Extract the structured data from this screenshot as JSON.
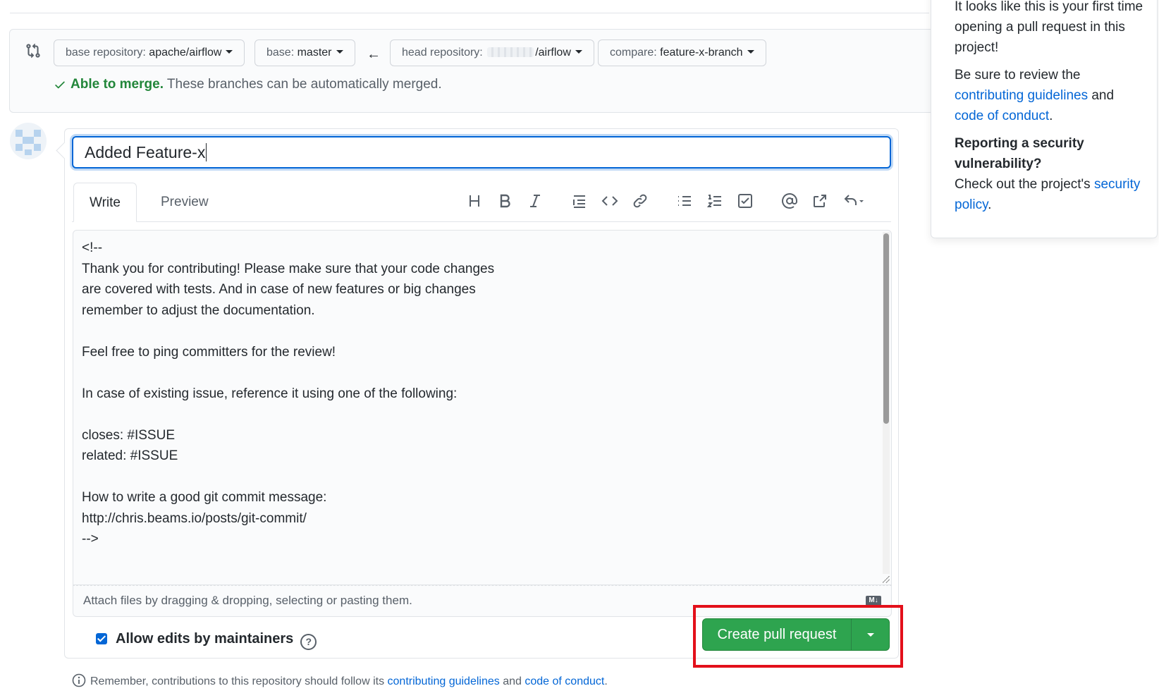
{
  "compare": {
    "base_repo_label": "base repository:",
    "base_repo_value": "apache/airflow",
    "base_label": "base:",
    "base_value": "master",
    "head_repo_label": "head repository:",
    "head_repo_value": "/airflow",
    "compare_label": "compare:",
    "compare_value": "feature-x-branch",
    "merge_ok": "Able to merge.",
    "merge_text": "These branches can be automatically merged."
  },
  "form": {
    "title_value": "Added Feature-x",
    "tab_write": "Write",
    "tab_preview": "Preview",
    "body_text": "<!--\nThank you for contributing! Please make sure that your code changes\nare covered with tests. And in case of new features or big changes\nremember to adjust the documentation.\n\nFeel free to ping committers for the review!\n\nIn case of existing issue, reference it using one of the following:\n\ncloses: #ISSUE\nrelated: #ISSUE\n\nHow to write a good git commit message:\nhttp://chris.beams.io/posts/git-commit/\n-->",
    "attach_text": "Attach files by dragging & dropping, selecting or pasting them.",
    "md_badge": "M↓",
    "allow_edits": "Allow edits by maintainers",
    "help_glyph": "?",
    "create_button": "Create pull request"
  },
  "footnote": {
    "prefix": "Remember, contributions to this repository should follow its",
    "link1": "contributing guidelines",
    "and": "and",
    "link2": "code of conduct",
    "suffix": "."
  },
  "side": {
    "intro_line": "It looks like this is your first time opening a pull request in this project!",
    "review_prefix": "Be sure to review the",
    "review_link1": "contributing guidelines",
    "review_and": "and",
    "review_link2": "code of conduct",
    "review_suffix": ".",
    "security_heading": "Reporting a security vulnerability?",
    "security_prefix": "Check out the project's",
    "security_link": "security policy",
    "security_suffix": "."
  },
  "colors": {
    "accent_blue": "#0366d6",
    "success_green": "#2ea44f",
    "highlight_red": "#e3101a"
  }
}
